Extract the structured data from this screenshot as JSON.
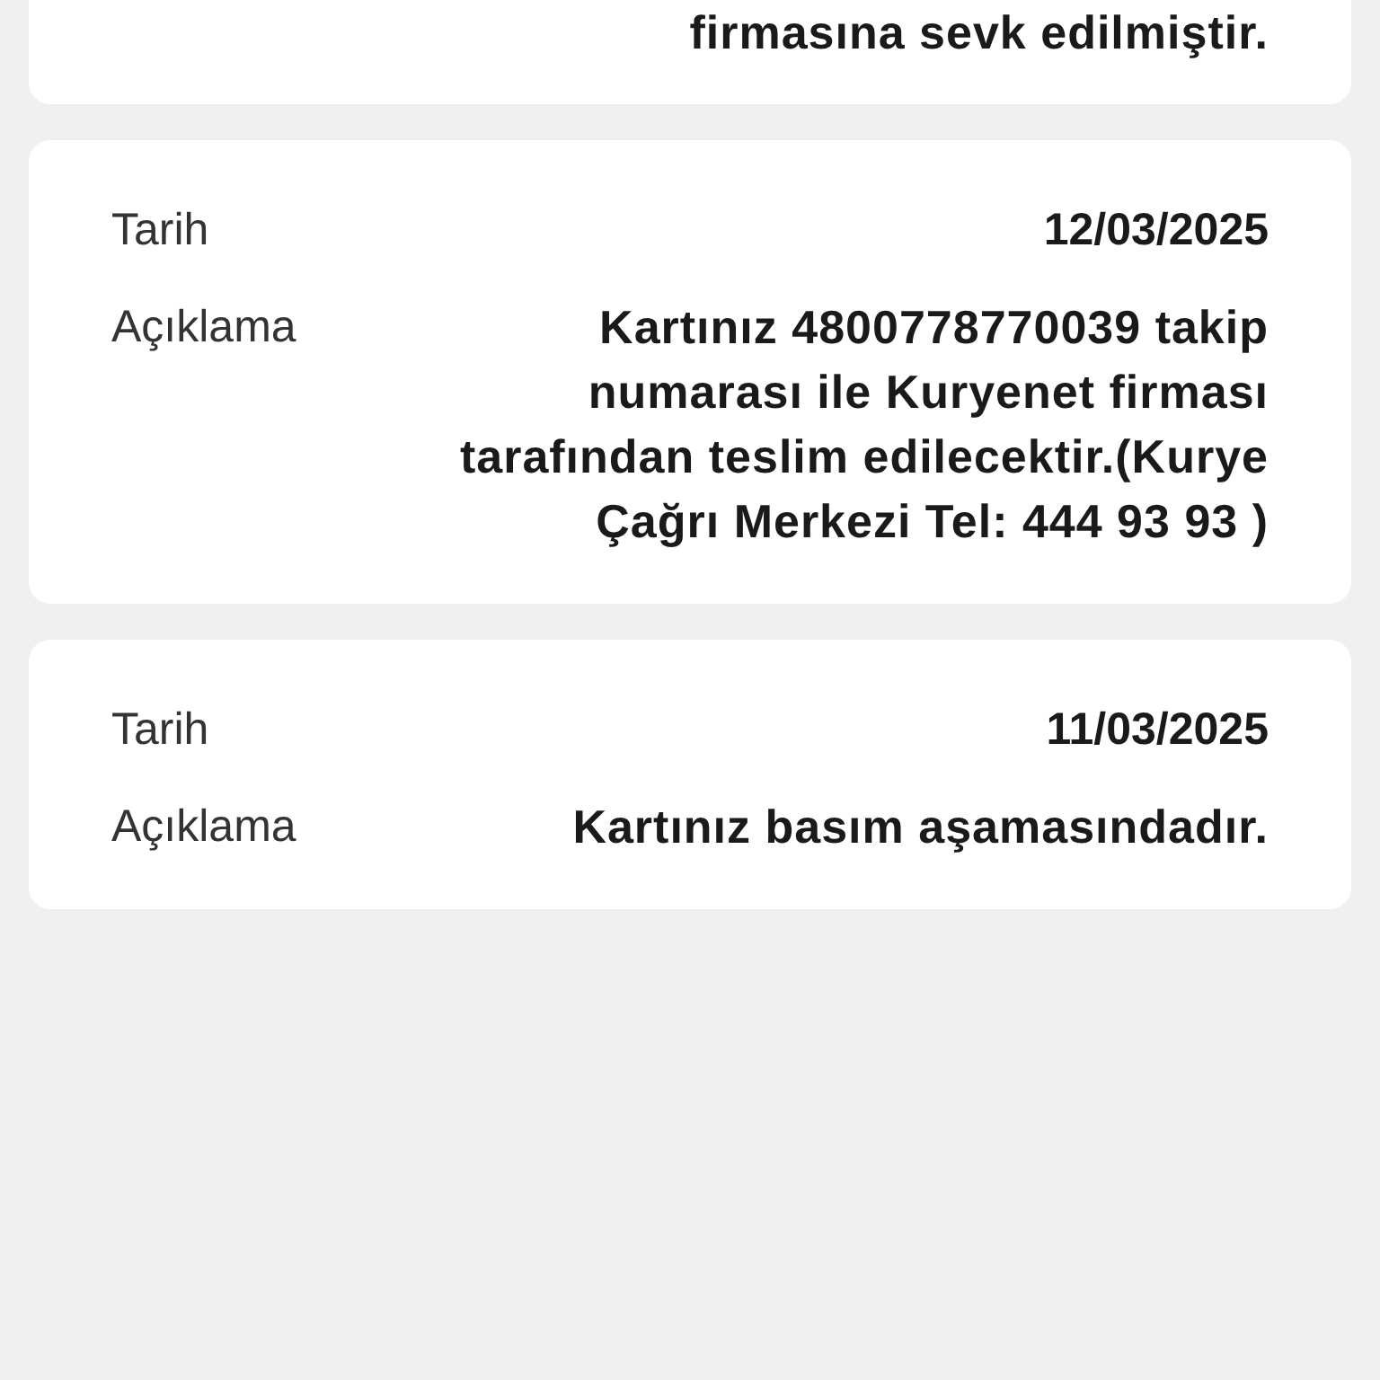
{
  "entries": [
    {
      "description": "firmasına sevk edilmiştir."
    },
    {
      "date_label": "Tarih",
      "date": "12/03/2025",
      "description_label": "Açıklama",
      "description": "Kartınız 4800778770039 takip numarası ile Kuryenet firması tarafından teslim edilecektir.(Kurye Çağrı Merkezi Tel: 444 93 93 )"
    },
    {
      "date_label": "Tarih",
      "date": "11/03/2025",
      "description_label": "Açıklama",
      "description": "Kartınız basım aşamasındadır."
    }
  ]
}
